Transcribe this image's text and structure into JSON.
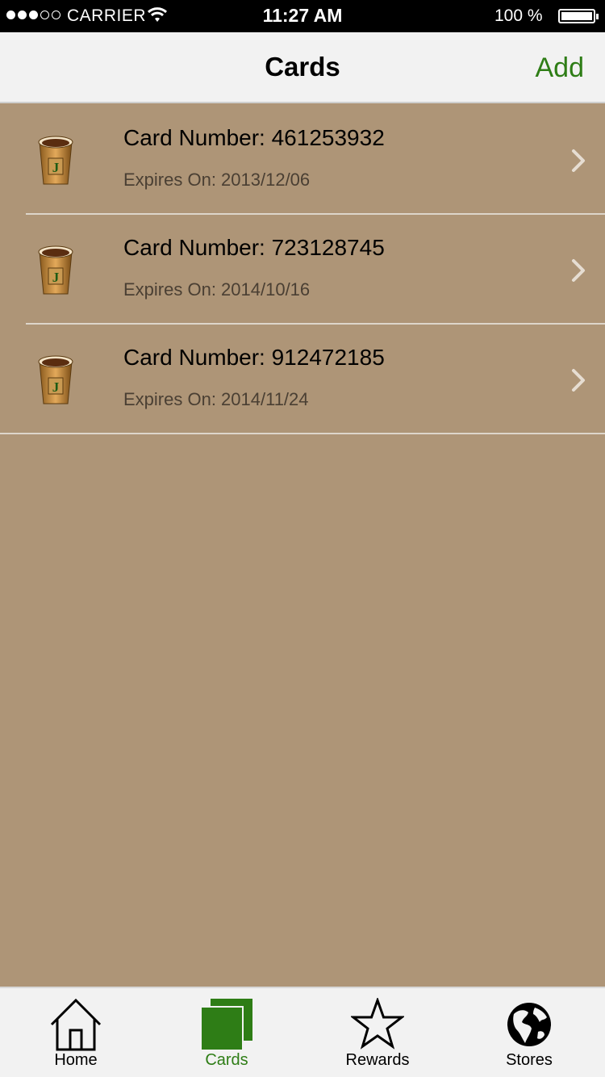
{
  "status_bar": {
    "carrier": "CARRIER",
    "time": "11:27 AM",
    "battery": "100 %"
  },
  "nav": {
    "title": "Cards",
    "add_label": "Add"
  },
  "cards": [
    {
      "number_text": "Card Number: 461253932",
      "expiry_text": "Expires On: 2013/12/06"
    },
    {
      "number_text": "Card Number: 723128745",
      "expiry_text": "Expires On: 2014/10/16"
    },
    {
      "number_text": "Card Number: 912472185",
      "expiry_text": "Expires On: 2014/11/24"
    }
  ],
  "tabs": [
    {
      "label": "Home",
      "icon": "home-icon"
    },
    {
      "label": "Cards",
      "icon": "cards-icon",
      "active": true
    },
    {
      "label": "Rewards",
      "icon": "star-icon"
    },
    {
      "label": "Stores",
      "icon": "globe-icon"
    }
  ],
  "colors": {
    "accent": "#2e7d16",
    "background": "#ae9577",
    "bar": "#f2f2f2"
  }
}
